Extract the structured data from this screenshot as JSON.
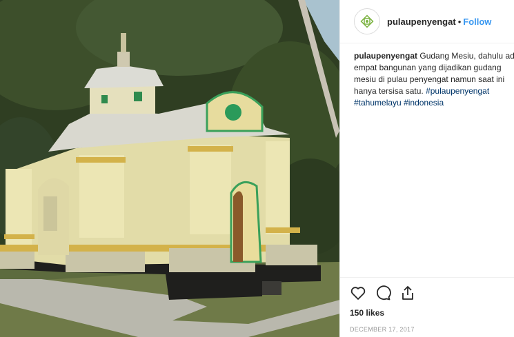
{
  "post": {
    "username": "pulaupenyengat",
    "separator": "•",
    "follow_label": "Follow",
    "caption": {
      "username": "pulaupenyengat",
      "text": "Gudang Mesiu, dahulu ada empat bangunan yang dijadikan gudang mesiu di pulau penyengat namun saat ini hanya tersisa satu.",
      "hashtags": [
        "#pulaupenyengat",
        "#tahumelayu",
        "#indonesia"
      ]
    },
    "likes": "150 likes",
    "date": "DECEMBER 17, 2017",
    "icons": [
      "heart-icon",
      "comment-icon",
      "share-icon"
    ],
    "colors": {
      "accent": "#3897f0",
      "hashtag": "#003569",
      "text": "#262626",
      "muted": "#999999"
    },
    "photo_alt": "Gudang Mesiu building photo"
  }
}
